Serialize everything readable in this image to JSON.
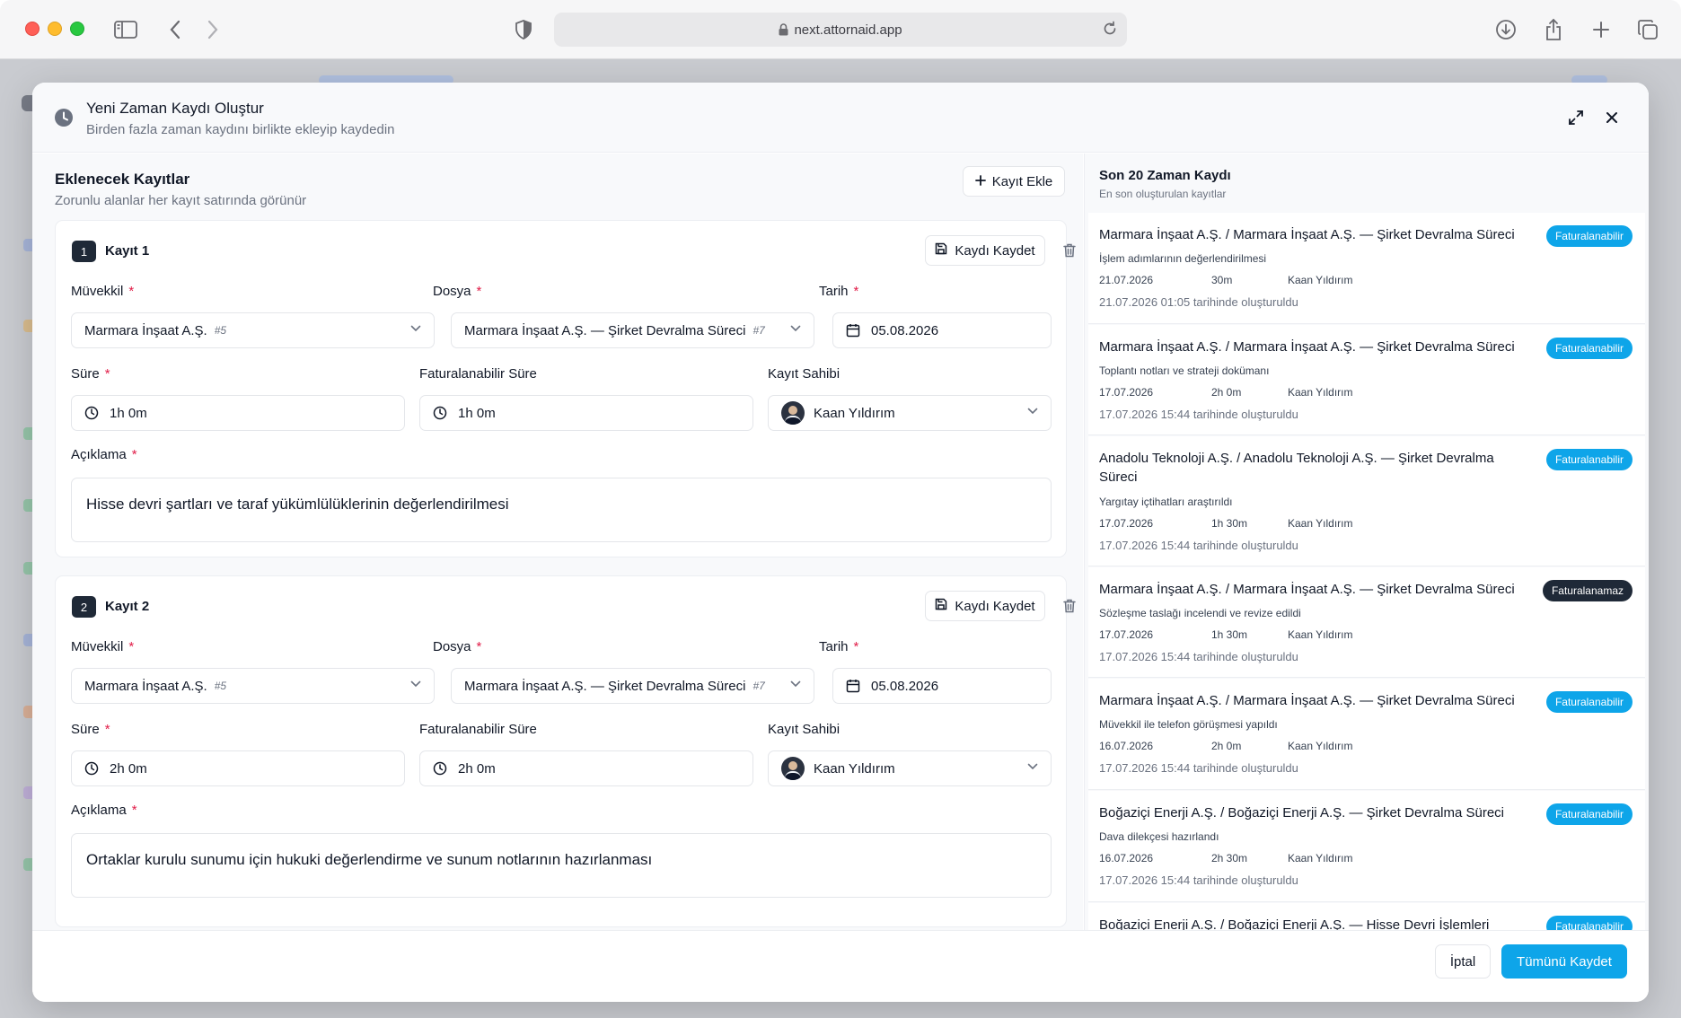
{
  "browser": {
    "url": "next.attornaid.app"
  },
  "modal": {
    "title": "Yeni Zaman Kaydı Oluştur",
    "subtitle": "Birden fazla zaman kaydını birlikte ekleyip kaydedin"
  },
  "entries_section": {
    "title": "Eklenecek Kayıtlar",
    "subtitle": "Zorunlu alanlar her kayıt satırında görünür",
    "add_label": "Kayıt Ekle"
  },
  "labels": {
    "client": "Müvekkil",
    "file": "Dosya",
    "date": "Tarih",
    "duration": "Süre",
    "billable": "Faturalanabilir Süre",
    "owner": "Kayıt Sahibi",
    "description": "Açıklama",
    "required_mark": "*",
    "save_one": "Kaydı Kaydet"
  },
  "records": [
    {
      "number": "1",
      "title": "Kayıt 1",
      "client": "Marmara İnşaat A.Ş.",
      "client_id": "#5",
      "file": "Marmara İnşaat A.Ş. — Şirket Devralma Süreci",
      "file_id": "#7",
      "date": "05.08.2026",
      "duration": "1h 0m",
      "billable": "1h 0m",
      "owner": "Kaan Yıldırım",
      "description": "Hisse devri şartları ve taraf yükümlülüklerinin değerlendirilmesi"
    },
    {
      "number": "2",
      "title": "Kayıt 2",
      "client": "Marmara İnşaat A.Ş.",
      "client_id": "#5",
      "file": "Marmara İnşaat A.Ş. — Şirket Devralma Süreci",
      "file_id": "#7",
      "date": "05.08.2026",
      "duration": "2h 0m",
      "billable": "2h 0m",
      "owner": "Kaan Yıldırım",
      "description": "Ortaklar kurulu sunumu için hukuki değerlendirme ve sunum notlarının hazırlanması"
    }
  ],
  "recent": {
    "title": "Son 20 Zaman Kaydı",
    "subtitle": "En son oluşturulan kayıtlar",
    "items": [
      {
        "title": "Marmara İnşaat A.Ş. / Marmara İnşaat A.Ş. — Şirket Devralma Süreci",
        "badge": "Faturalanabilir",
        "badge_color": "#0ea5e9",
        "desc": "İşlem adımlarının değerlendirilmesi",
        "date": "21.07.2026",
        "duration": "30m",
        "user": "Kaan Yıldırım",
        "created": "21.07.2026 01:05 tarihinde oluşturuldu"
      },
      {
        "title": "Marmara İnşaat A.Ş. / Marmara İnşaat A.Ş. — Şirket Devralma Süreci",
        "badge": "Faturalanabilir",
        "badge_color": "#0ea5e9",
        "desc": "Toplantı notları ve strateji dokümanı",
        "date": "17.07.2026",
        "duration": "2h 0m",
        "user": "Kaan Yıldırım",
        "created": "17.07.2026 15:44 tarihinde oluşturuldu"
      },
      {
        "title": "Anadolu Teknoloji A.Ş. / Anadolu Teknoloji A.Ş. — Şirket Devralma Süreci",
        "badge": "Faturalanabilir",
        "badge_color": "#0ea5e9",
        "desc": "Yargıtay içtihatları araştırıldı",
        "date": "17.07.2026",
        "duration": "1h 30m",
        "user": "Kaan Yıldırım",
        "created": "17.07.2026 15:44 tarihinde oluşturuldu"
      },
      {
        "title": "Marmara İnşaat A.Ş. / Marmara İnşaat A.Ş. — Şirket Devralma Süreci",
        "badge": "Faturalanamaz",
        "badge_color": "#1f2937",
        "desc": "Sözleşme taslağı incelendi ve revize edildi",
        "date": "17.07.2026",
        "duration": "1h 30m",
        "user": "Kaan Yıldırım",
        "created": "17.07.2026 15:44 tarihinde oluşturuldu"
      },
      {
        "title": "Marmara İnşaat A.Ş. / Marmara İnşaat A.Ş. — Şirket Devralma Süreci",
        "badge": "Faturalanabilir",
        "badge_color": "#0ea5e9",
        "desc": "Müvekkil ile telefon görüşmesi yapıldı",
        "date": "16.07.2026",
        "duration": "2h 0m",
        "user": "Kaan Yıldırım",
        "created": "17.07.2026 15:44 tarihinde oluşturuldu"
      },
      {
        "title": "Boğaziçi Enerji A.Ş. / Boğaziçi Enerji A.Ş. — Şirket Devralma Süreci",
        "badge": "Faturalanabilir",
        "badge_color": "#0ea5e9",
        "desc": "Dava dilekçesi hazırlandı",
        "date": "16.07.2026",
        "duration": "2h 30m",
        "user": "Kaan Yıldırım",
        "created": "17.07.2026 15:44 tarihinde oluşturuldu"
      },
      {
        "title": "Boğaziçi Enerji A.Ş. / Boğaziçi Enerji A.Ş. — Hisse Devri İşlemleri",
        "badge": "Faturalanabilir",
        "badge_color": "#0ea5e9",
        "desc": "",
        "date": "",
        "duration": "",
        "user": "",
        "created": ""
      }
    ]
  },
  "footer": {
    "cancel": "İptal",
    "save_all": "Tümünü Kaydet"
  },
  "colors": {
    "accent": "#0ea5e9",
    "dark_badge": "#1f2937",
    "required": "#e11d48"
  }
}
